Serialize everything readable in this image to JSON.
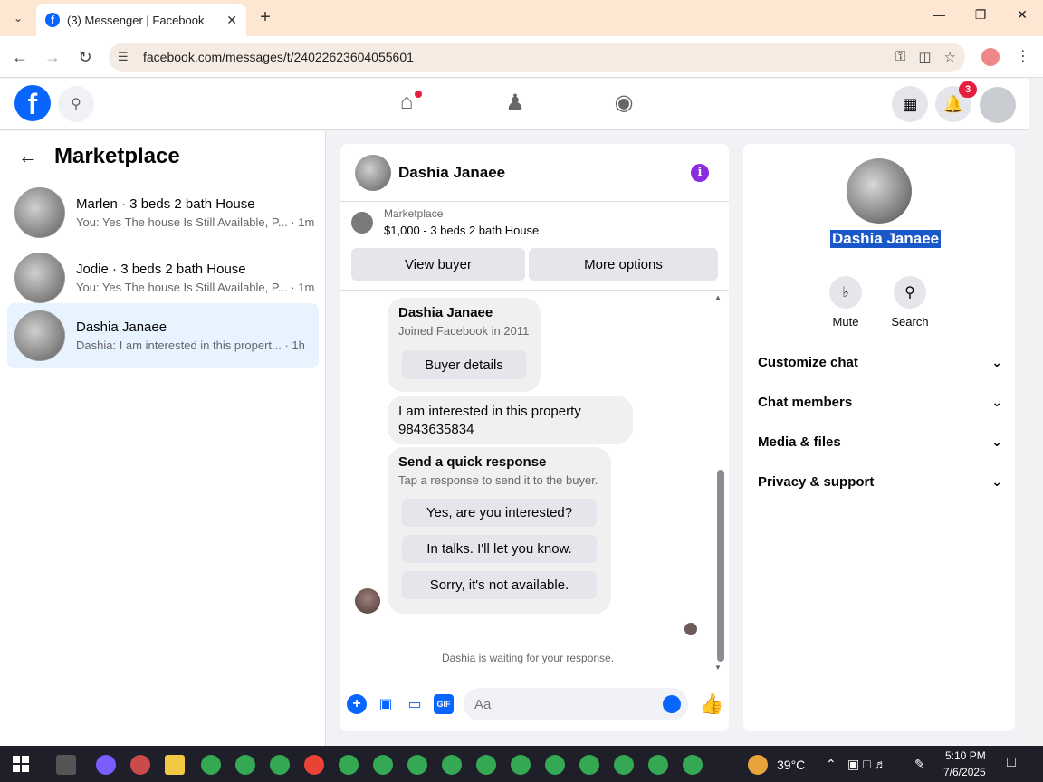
{
  "browser": {
    "tab_title": "(3) Messenger | Facebook",
    "url": "facebook.com/messages/t/24022623604055601"
  },
  "fb": {
    "notification_count": "3"
  },
  "sidebar": {
    "title": "Marketplace",
    "conversations": [
      {
        "name": "Marlen · 3 beds 2 bath House",
        "preview": "You: Yes The house Is Still Available, P... · 1m"
      },
      {
        "name": "Jodie · 3 beds 2 bath House",
        "preview": "You: Yes The house Is Still Available, P... · 1m"
      },
      {
        "name": "Dashia Janaee",
        "preview": "Dashia: I am interested in this propert... · 1h"
      }
    ]
  },
  "chat": {
    "contact_name": "Dashia Janaee",
    "marketplace_label": "Marketplace",
    "listing": "$1,000 - 3 beds 2 bath House",
    "view_buyer": "View buyer",
    "more_options": "More options",
    "profile_card": {
      "name": "Dashia Janaee",
      "joined": "Joined Facebook in 2011",
      "button": "Buyer details"
    },
    "message": {
      "line1": "I am interested in this property",
      "line2": "9843635834"
    },
    "quick_response": {
      "title": "Send a quick response",
      "subtitle": "Tap a response to send it to the buyer.",
      "options": [
        "Yes, are you interested?",
        "In talks. I'll let you know.",
        "Sorry, it's not available."
      ]
    },
    "waiting": "Dashia is waiting for your response.",
    "input_placeholder": "Aa"
  },
  "details": {
    "name": "Dashia Janaee",
    "actions": [
      {
        "label": "Mute",
        "icon": "bell-icon"
      },
      {
        "label": "Search",
        "icon": "search-icon"
      }
    ],
    "sections": [
      "Customize chat",
      "Chat members",
      "Media & files",
      "Privacy & support"
    ]
  },
  "taskbar": {
    "temperature": "39°C",
    "time": "5:10 PM",
    "date": "7/6/2025"
  }
}
